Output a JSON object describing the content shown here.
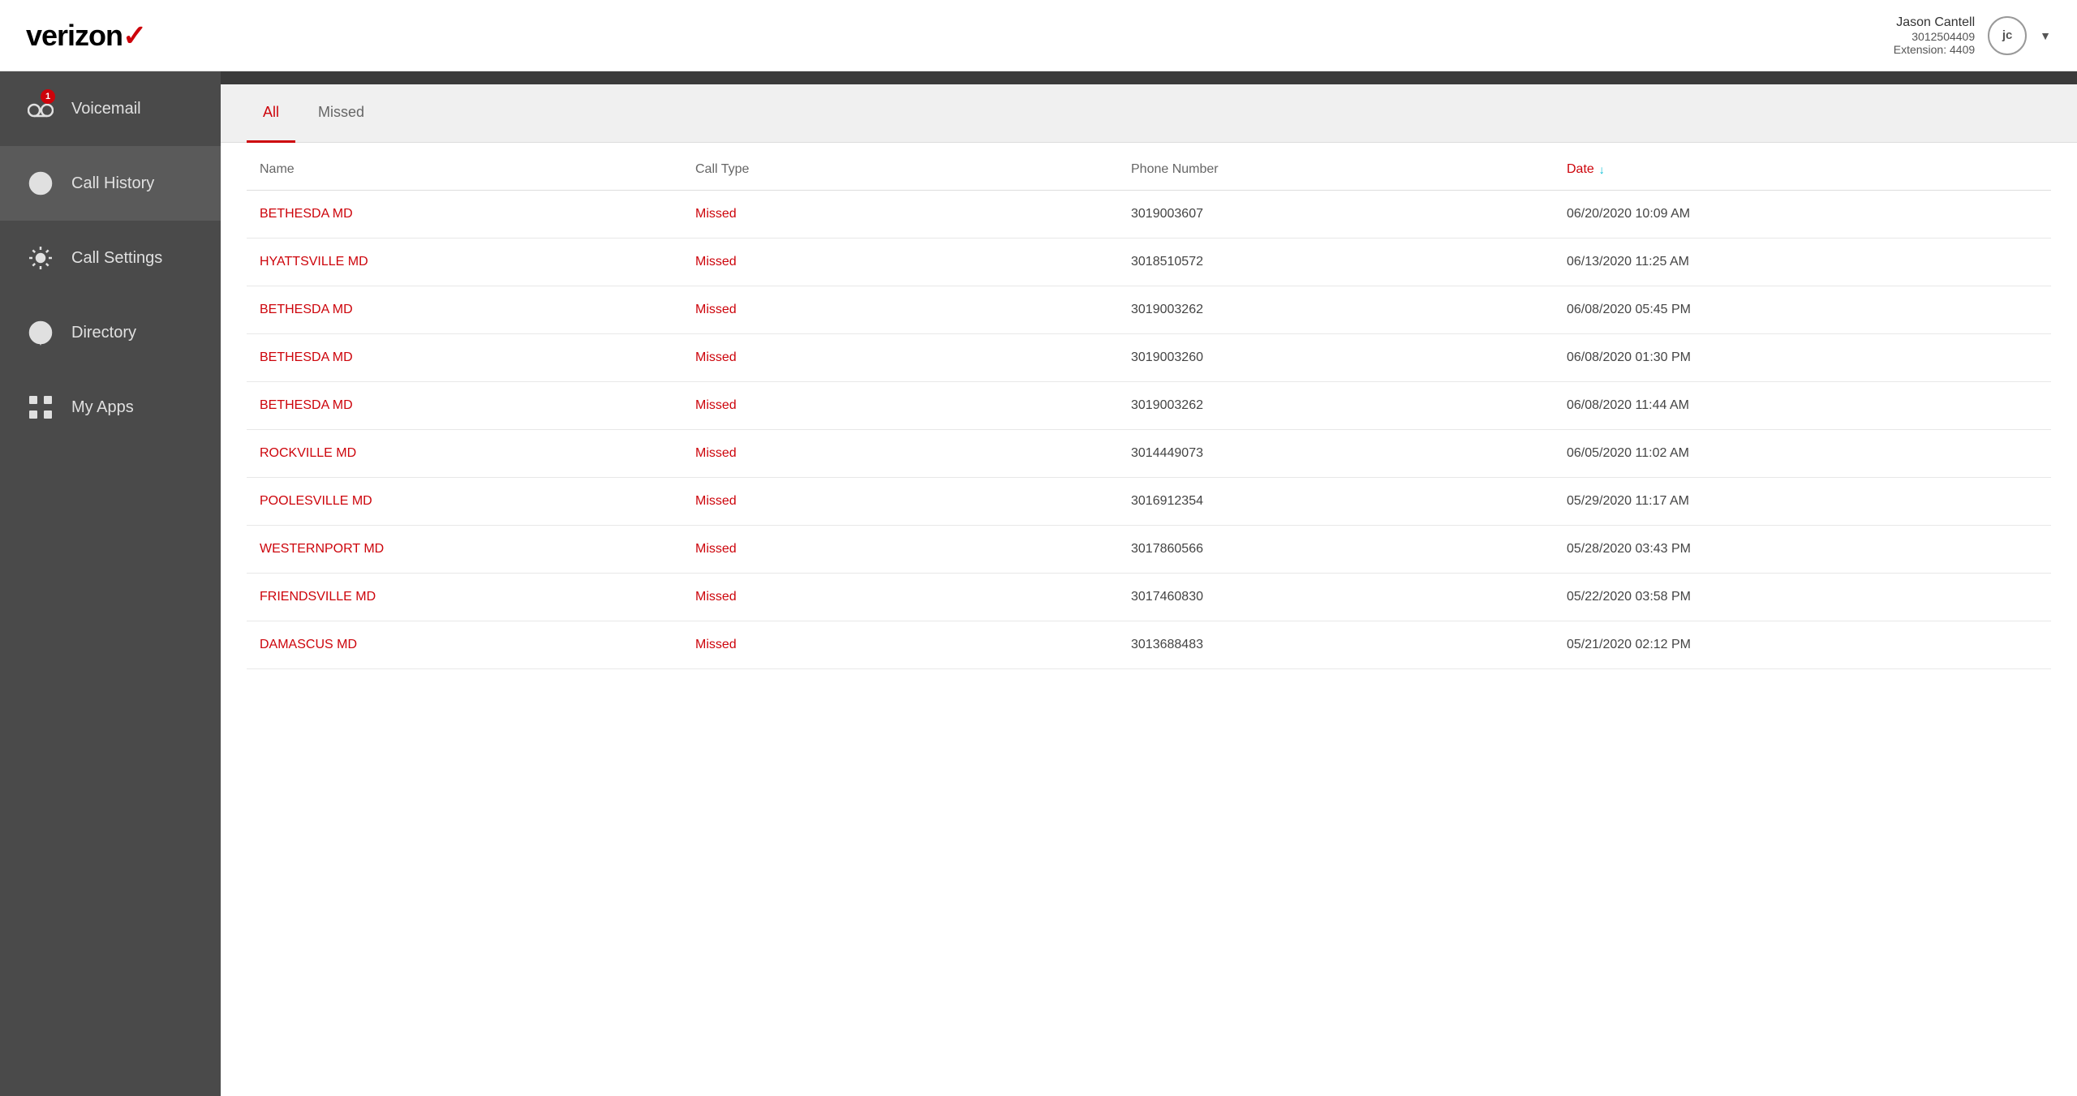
{
  "header": {
    "logo_text": "verizon",
    "logo_check": "✓",
    "user": {
      "name": "Jason Cantell",
      "phone": "3012504409",
      "extension": "Extension: 4409",
      "initials": "jc"
    }
  },
  "sidebar": {
    "items": [
      {
        "id": "voicemail",
        "label": "Voicemail",
        "badge": "1",
        "active": false
      },
      {
        "id": "call-history",
        "label": "Call History",
        "badge": null,
        "active": true
      },
      {
        "id": "call-settings",
        "label": "Call Settings",
        "badge": null,
        "active": false
      },
      {
        "id": "directory",
        "label": "Directory",
        "badge": null,
        "active": false
      },
      {
        "id": "my-apps",
        "label": "My Apps",
        "badge": null,
        "active": false
      }
    ]
  },
  "tabs": [
    {
      "id": "all",
      "label": "All",
      "active": true
    },
    {
      "id": "missed",
      "label": "Missed",
      "active": false
    }
  ],
  "table": {
    "headers": {
      "name": "Name",
      "call_type": "Call Type",
      "phone_number": "Phone Number",
      "date": "Date"
    },
    "rows": [
      {
        "name": "BETHESDA MD",
        "call_type": "Missed",
        "phone": "3019003607",
        "date": "06/20/2020 10:09 AM"
      },
      {
        "name": "HYATTSVILLE MD",
        "call_type": "Missed",
        "phone": "3018510572",
        "date": "06/13/2020 11:25 AM"
      },
      {
        "name": "BETHESDA MD",
        "call_type": "Missed",
        "phone": "3019003262",
        "date": "06/08/2020 05:45 PM"
      },
      {
        "name": "BETHESDA MD",
        "call_type": "Missed",
        "phone": "3019003260",
        "date": "06/08/2020 01:30 PM"
      },
      {
        "name": "BETHESDA MD",
        "call_type": "Missed",
        "phone": "3019003262",
        "date": "06/08/2020 11:44 AM"
      },
      {
        "name": "ROCKVILLE MD",
        "call_type": "Missed",
        "phone": "3014449073",
        "date": "06/05/2020 11:02 AM"
      },
      {
        "name": "POOLESVILLE MD",
        "call_type": "Missed",
        "phone": "3016912354",
        "date": "05/29/2020 11:17 AM"
      },
      {
        "name": "WESTERNPORT MD",
        "call_type": "Missed",
        "phone": "3017860566",
        "date": "05/28/2020 03:43 PM"
      },
      {
        "name": "FRIENDSVILLE MD",
        "call_type": "Missed",
        "phone": "3017460830",
        "date": "05/22/2020 03:58 PM"
      },
      {
        "name": "DAMASCUS MD",
        "call_type": "Missed",
        "phone": "3013688483",
        "date": "05/21/2020 02:12 PM"
      }
    ]
  }
}
